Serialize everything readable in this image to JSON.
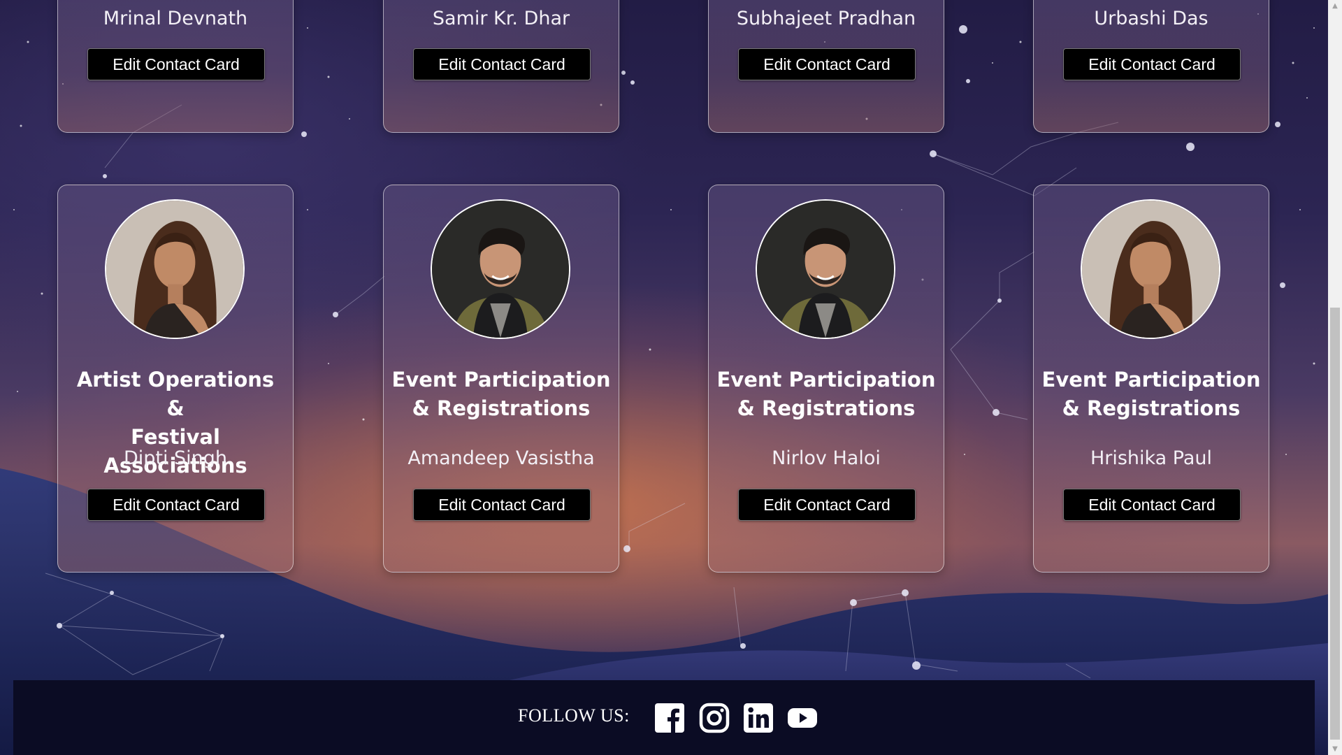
{
  "top_row": [
    {
      "name": "Mrinal Devnath",
      "button": "Edit Contact Card"
    },
    {
      "name": "Samir Kr. Dhar",
      "button": "Edit Contact Card"
    },
    {
      "name": "Subhajeet Pradhan",
      "button": "Edit Contact Card"
    },
    {
      "name": "Urbashi Das",
      "button": "Edit Contact Card"
    }
  ],
  "bottom_row": [
    {
      "role_line1": "Artist Operations &",
      "role_line2": "Festival Associations",
      "name": "Dipti Singh",
      "button": "Edit Contact Card",
      "avatar": "woman-portrait"
    },
    {
      "role_line1": "Event Participation",
      "role_line2": "& Registrations",
      "name": "Amandeep Vasistha",
      "button": "Edit Contact Card",
      "avatar": "man-portrait"
    },
    {
      "role_line1": "Event Participation",
      "role_line2": "& Registrations",
      "name": "Nirlov Haloi",
      "button": "Edit Contact Card",
      "avatar": "man-portrait"
    },
    {
      "role_line1": "Event Participation",
      "role_line2": "& Registrations",
      "name": "Hrishika Paul",
      "button": "Edit Contact Card",
      "avatar": "woman-portrait"
    }
  ],
  "footer": {
    "follow_label": "FOLLOW US:",
    "social": [
      "facebook-icon",
      "instagram-icon",
      "linkedin-icon",
      "youtube-icon"
    ]
  },
  "colors": {
    "button_bg": "#000000",
    "footer_bg": "#0b0c24",
    "card_border": "#ffffff"
  }
}
